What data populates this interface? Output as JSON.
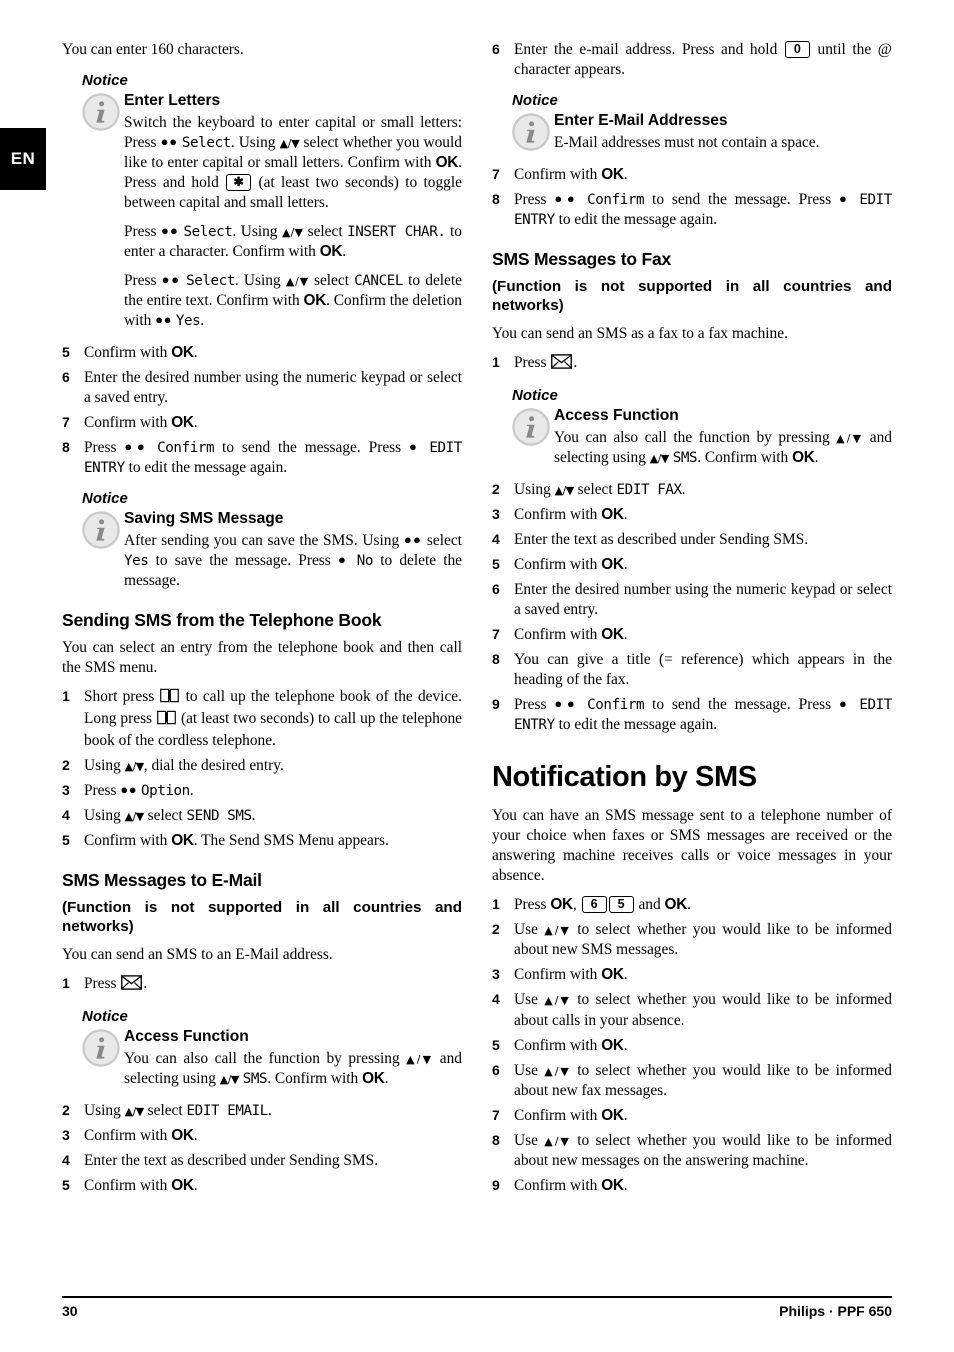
{
  "language_tab": "EN",
  "footer": {
    "page_number": "30",
    "brand": "Philips · PPF 650"
  },
  "labels": {
    "notice": "Notice"
  },
  "left_column": {
    "intro": "You can enter 160 characters.",
    "notice_enter_letters": {
      "title": "Enter Letters",
      "para1_a": "Switch the keyboard to enter capital or small letters: Press",
      "para1_softkey": "●●",
      "para1_disp": "Select",
      "para1_b": ". Using",
      "para1_arrows": "▲/▼",
      "para1_c": "select whether you would like to enter capital or small letters. Confirm with",
      "para1_ok": "OK",
      "para1_d": ". Press and hold",
      "para1_key": "✱",
      "para1_e": "(at least two seconds) to toggle between capital and small letters.",
      "para2_a": "Press",
      "para2_softkey": "●●",
      "para2_disp1": "Select",
      "para2_b": ". Using",
      "para2_arrows": "▲/▼",
      "para2_c": "select",
      "para2_disp2": "INSERT CHAR.",
      "para2_d": "to enter a character. Confirm with",
      "para2_ok": "OK",
      "para2_e": ".",
      "para3_a": "Press",
      "para3_softkey": "●●",
      "para3_disp1": "Select",
      "para3_b": ". Using",
      "para3_arrows": "▲/▼",
      "para3_c": "select",
      "para3_disp2": "CANCEL",
      "para3_d": "to delete the entire text. Confirm with",
      "para3_ok": "OK",
      "para3_e": ". Confirm the deletion with",
      "para3_softkey2": "●●",
      "para3_disp3": "Yes",
      "para3_f": "."
    },
    "steps_sending": [
      {
        "num": "5",
        "a": "Confirm with",
        "ok": "OK",
        "b": "."
      },
      {
        "num": "6",
        "a": "Enter the desired number using the numeric keypad or select a saved entry."
      },
      {
        "num": "7",
        "a": "Confirm with",
        "ok": "OK",
        "b": "."
      },
      {
        "num": "8",
        "a": "Press",
        "softkey": "●●",
        "disp1": "Confirm",
        "b": "to send the message. Press",
        "softkey2": "●",
        "disp2": "EDIT ENTRY",
        "c": "to edit the message again."
      }
    ],
    "notice_saving_sms": {
      "title": "Saving SMS Message",
      "a": "After sending you can save the SMS. Using",
      "softkey1": "●●",
      "b": "select",
      "disp1": "Yes",
      "c": "to save the message. Press",
      "softkey2": "●",
      "disp2": "No",
      "d": "to delete the message."
    },
    "section_phonebook": {
      "heading": "Sending SMS from the Telephone Book",
      "intro": "You can select an entry from the telephone book and then call the SMS menu.",
      "steps": [
        {
          "num": "1",
          "a": "Short press",
          "icon1": "book-icon",
          "b": "to call up the telephone book of the device. Long press",
          "icon2": "book-icon",
          "c": "(at least two seconds) to call up the telephone book of the cordless telephone."
        },
        {
          "num": "2",
          "a": "Using",
          "arrows": "▲/▼",
          "b": ", dial the desired entry."
        },
        {
          "num": "3",
          "a": "Press",
          "softkey": "●●",
          "disp": "Option",
          "b": "."
        },
        {
          "num": "4",
          "a": "Using",
          "arrows": "▲/▼",
          "b": "select",
          "disp": "SEND SMS",
          "c": "."
        },
        {
          "num": "5",
          "a": "Confirm with",
          "ok": "OK",
          "b": ". The Send SMS Menu appears."
        }
      ]
    },
    "section_email": {
      "heading": "SMS Messages to E-Mail",
      "subhead": "(Function is not supported in all countries and networks)",
      "intro": "You can send an SMS to an E-Mail address.",
      "step1": {
        "num": "1",
        "a": "Press",
        "icon": "envelope-icon",
        "b": "."
      },
      "notice_access": {
        "title": "Access Function",
        "a": "You can also call the function by pressing",
        "arrows1": "▲/▼",
        "b": "and selecting using",
        "arrows2": "▲/▼",
        "disp": "SMS",
        "c": ". Confirm with",
        "ok": "OK",
        "d": "."
      },
      "steps": [
        {
          "num": "2",
          "a": "Using",
          "arrows": "▲/▼",
          "b": "select",
          "disp": "EDIT EMAIL",
          "c": "."
        },
        {
          "num": "3",
          "a": "Confirm with",
          "ok": "OK",
          "b": "."
        },
        {
          "num": "4",
          "a": "Enter the text as described under Sending SMS."
        },
        {
          "num": "5",
          "a": "Confirm with",
          "ok": "OK",
          "b": "."
        }
      ]
    }
  },
  "right_column": {
    "step6": {
      "num": "6",
      "a": "Enter the e-mail address. Press and hold",
      "key": "0",
      "b": "until the @ character appears."
    },
    "notice_email_addresses": {
      "title": "Enter E-Mail Addresses",
      "text": "E-Mail addresses must not contain a space."
    },
    "steps_after": [
      {
        "num": "7",
        "a": "Confirm with",
        "ok": "OK",
        "b": "."
      },
      {
        "num": "8",
        "a": "Press",
        "softkey": "●●",
        "disp1": "Confirm",
        "b": "to send the message. Press",
        "softkey2": "●",
        "disp2": "EDIT ENTRY",
        "c": "to edit the message again."
      }
    ],
    "section_fax": {
      "heading": "SMS Messages to Fax",
      "subhead": "(Function is not supported in all countries and networks)",
      "intro": "You can send an SMS as a fax to a fax machine.",
      "step1": {
        "num": "1",
        "a": "Press",
        "icon": "envelope-icon",
        "b": "."
      },
      "notice_access": {
        "title": "Access Function",
        "a": "You can also call the function by pressing",
        "arrows1": "▲/▼",
        "b": "and selecting using",
        "arrows2": "▲/▼",
        "disp": "SMS",
        "c": ". Confirm with",
        "ok": "OK",
        "d": "."
      },
      "steps": [
        {
          "num": "2",
          "a": "Using",
          "arrows": "▲/▼",
          "b": "select",
          "disp": "EDIT FAX",
          "c": "."
        },
        {
          "num": "3",
          "a": "Confirm with",
          "ok": "OK",
          "b": "."
        },
        {
          "num": "4",
          "a": "Enter the text as described under Sending SMS."
        },
        {
          "num": "5",
          "a": "Confirm with",
          "ok": "OK",
          "b": "."
        },
        {
          "num": "6",
          "a": "Enter the desired number using the numeric keypad or select a saved entry."
        },
        {
          "num": "7",
          "a": "Confirm with",
          "ok": "OK",
          "b": "."
        },
        {
          "num": "8",
          "a": "You can give a title (= reference) which appears in the heading of the fax."
        },
        {
          "num": "9",
          "a": "Press",
          "softkey": "●●",
          "disp1": "Confirm",
          "b": "to send the message. Press",
          "softkey2": "●",
          "disp2": "EDIT ENTRY",
          "c": "to edit the message again."
        }
      ]
    },
    "chapter_notification": {
      "heading": "Notification by SMS",
      "intro": "You can have an SMS message sent to a telephone number of your choice when faxes or SMS messages are received or the answering machine receives calls or voice messages in your absence.",
      "steps": [
        {
          "num": "1",
          "a": "Press",
          "ok1": "OK",
          "comma": ",",
          "key1": "6",
          "key2": "5",
          "b": "and",
          "ok2": "OK",
          "c": "."
        },
        {
          "num": "2",
          "a": "Use",
          "arrows": "▲/▼",
          "b": "to select whether you would like to be informed about new SMS messages."
        },
        {
          "num": "3",
          "a": "Confirm with",
          "ok": "OK",
          "b": "."
        },
        {
          "num": "4",
          "a": "Use",
          "arrows": "▲/▼",
          "b": "to select whether you would like to be informed about calls in your absence."
        },
        {
          "num": "5",
          "a": "Confirm with",
          "ok": "OK",
          "b": "."
        },
        {
          "num": "6",
          "a": "Use",
          "arrows": "▲/▼",
          "b": "to select whether you would like to be informed about new fax messages."
        },
        {
          "num": "7",
          "a": "Confirm with",
          "ok": "OK",
          "b": "."
        },
        {
          "num": "8",
          "a": "Use",
          "arrows": "▲/▼",
          "b": "to select whether you would like to be informed about new messages on the answering machine."
        },
        {
          "num": "9",
          "a": "Confirm with",
          "ok": "OK",
          "b": "."
        }
      ]
    }
  }
}
